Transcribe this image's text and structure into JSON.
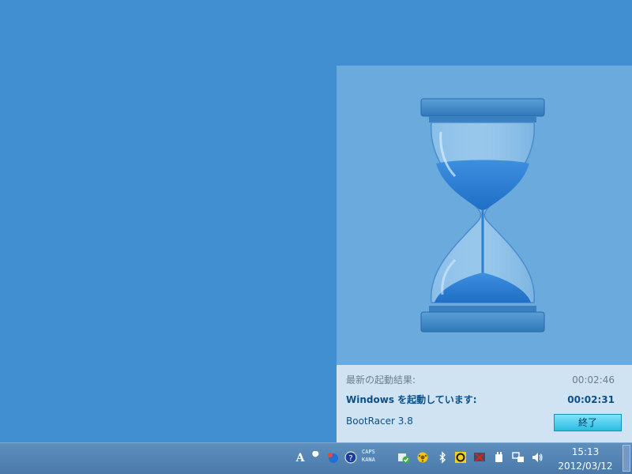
{
  "app": {
    "name": "BootRacer 3.8",
    "latest_label": "最新の起動結果:",
    "latest_value": "00:02:46",
    "current_label": "Windows を起動しています:",
    "current_value": "00:02:31",
    "exit_label": "終了"
  },
  "taskbar": {
    "caps_label": "CAPS",
    "kana_label": "KANA",
    "time": "15:13",
    "date": "2012/03/12",
    "tray_icons": [
      "ime-a-icon",
      "wrench-icon",
      "network-ball-icon",
      "help-icon",
      "shield-check-icon",
      "sun-gear-icon",
      "bluetooth-icon",
      "orange-circle-icon",
      "red-x-icon",
      "usb-plug-icon",
      "network-monitor-icon",
      "volume-icon"
    ]
  },
  "colors": {
    "desktop": "#418fd1",
    "panel": "#6aaadd",
    "info_bg": "#cfe3f3",
    "accent_text": "#0d4f86",
    "button": "#2bbbe4"
  }
}
